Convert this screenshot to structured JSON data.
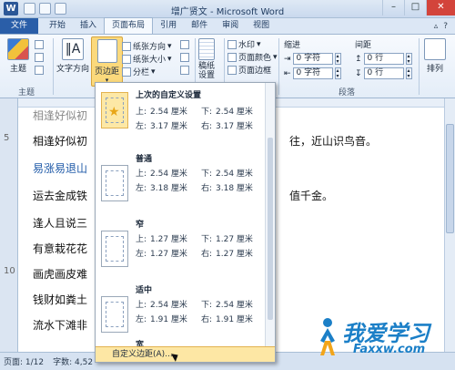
{
  "window": {
    "title": "增广贤文 - Microsoft Word",
    "controls": [
      "–",
      "□",
      "✕"
    ]
  },
  "tabs": [
    "文件",
    "开始",
    "插入",
    "页面布局",
    "引用",
    "邮件",
    "审阅",
    "视图"
  ],
  "ribbon": {
    "theme_group": {
      "theme": "主题",
      "label": "主题"
    },
    "page_setup": {
      "text_direction": "文字方向",
      "margins": "页边距",
      "orientation": "纸张方向",
      "size": "纸张大小",
      "columns": "分栏",
      "draft_paper": "稿纸\n设置"
    },
    "background": {
      "watermark": "水印",
      "page_color": "页面颜色",
      "page_border": "页面边框"
    },
    "paragraph": {
      "indent": "缩进",
      "spacing": "间距",
      "left_value": "0 字符",
      "right_value": "0 字符",
      "before_value": "0 行",
      "after_value": "0 行",
      "label": "段落"
    },
    "arrange": "排列"
  },
  "document": {
    "lines": [
      {
        "n": "5",
        "text": "相逢好似初",
        "rest": "往，近山识鸟音。"
      },
      {
        "n": "",
        "text": "易涨易退山",
        "rest": "",
        "blue": true
      },
      {
        "n": "",
        "text": "运去金成铁",
        "rest": "值千金。"
      },
      {
        "n": "",
        "text": "逢人且说三",
        "rest": ""
      },
      {
        "n": "",
        "text": "有意栽花花",
        "rest": ""
      },
      {
        "n": "10",
        "text": "画虎画皮难",
        "rest": ""
      },
      {
        "n": "",
        "text": "钱财如粪土",
        "rest": ""
      },
      {
        "n": "",
        "text": "流水下滩非",
        "rest": ""
      }
    ],
    "top_fragment": "相逢好似初"
  },
  "margins_menu": {
    "items": [
      {
        "name": "上次的自定义设置",
        "top": "2.54 厘米",
        "bottom": "2.54 厘米",
        "left": "3.17 厘米",
        "right": "3.17 厘米",
        "highlight": true
      },
      {
        "name": "普通",
        "top": "2.54 厘米",
        "bottom": "2.54 厘米",
        "left": "3.18 厘米",
        "right": "3.18 厘米"
      },
      {
        "name": "窄",
        "top": "1.27 厘米",
        "bottom": "1.27 厘米",
        "left": "1.27 厘米",
        "right": "1.27 厘米"
      },
      {
        "name": "适中",
        "top": "2.54 厘米",
        "bottom": "2.54 厘米",
        "left": "1.91 厘米",
        "right": "1.91 厘米"
      },
      {
        "name": "宽",
        "top": "",
        "bottom": "",
        "left": "",
        "right": ""
      }
    ],
    "labels": {
      "top": "上:",
      "bottom": "下:",
      "left": "左:",
      "right": "右:"
    },
    "custom": "自定义边距(A)..."
  },
  "status": {
    "page": "页面: 1/12",
    "words": "字数: 4,52"
  },
  "watermark": {
    "main": "我爱学习",
    "url": "Faxxw.com"
  }
}
